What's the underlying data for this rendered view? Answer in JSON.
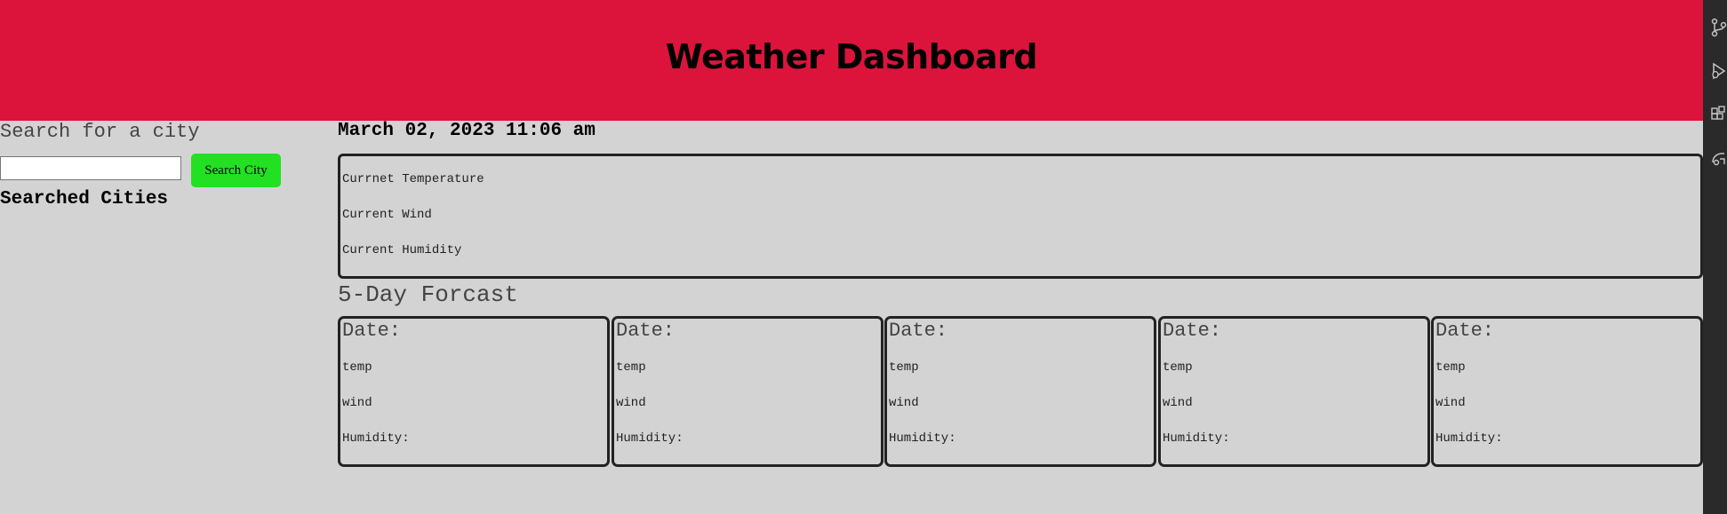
{
  "header": {
    "title": "Weather Dashboard"
  },
  "sidebar": {
    "search_label": "Search for a city",
    "search_input": {
      "value": "",
      "placeholder": ""
    },
    "search_button": "Search City",
    "searched_title": "Searched Cities"
  },
  "current": {
    "date_time": "March 02, 2023 11:06 am",
    "temperature": "Currnet Temperature",
    "wind": "Current Wind",
    "humidity": "Current Humidity"
  },
  "forecast": {
    "title": "5-Day Forcast",
    "cards": [
      {
        "date": "Date:",
        "temp": "temp",
        "wind": "wind",
        "humidity": "Humidity:"
      },
      {
        "date": "Date:",
        "temp": "temp",
        "wind": "wind",
        "humidity": "Humidity:"
      },
      {
        "date": "Date:",
        "temp": "temp",
        "wind": "wind",
        "humidity": "Humidity:"
      },
      {
        "date": "Date:",
        "temp": "temp",
        "wind": "wind",
        "humidity": "Humidity:"
      },
      {
        "date": "Date:",
        "temp": "temp",
        "wind": "wind",
        "humidity": "Humidity:"
      }
    ]
  },
  "right_rail": {
    "icons": [
      "source-control-icon",
      "debug-icon",
      "extensions-icon",
      "remote-explorer-icon"
    ]
  },
  "colors": {
    "header": "#dc143c",
    "page_background": "#d3d3d3",
    "search_button": "#22e022",
    "border": "#222222"
  }
}
